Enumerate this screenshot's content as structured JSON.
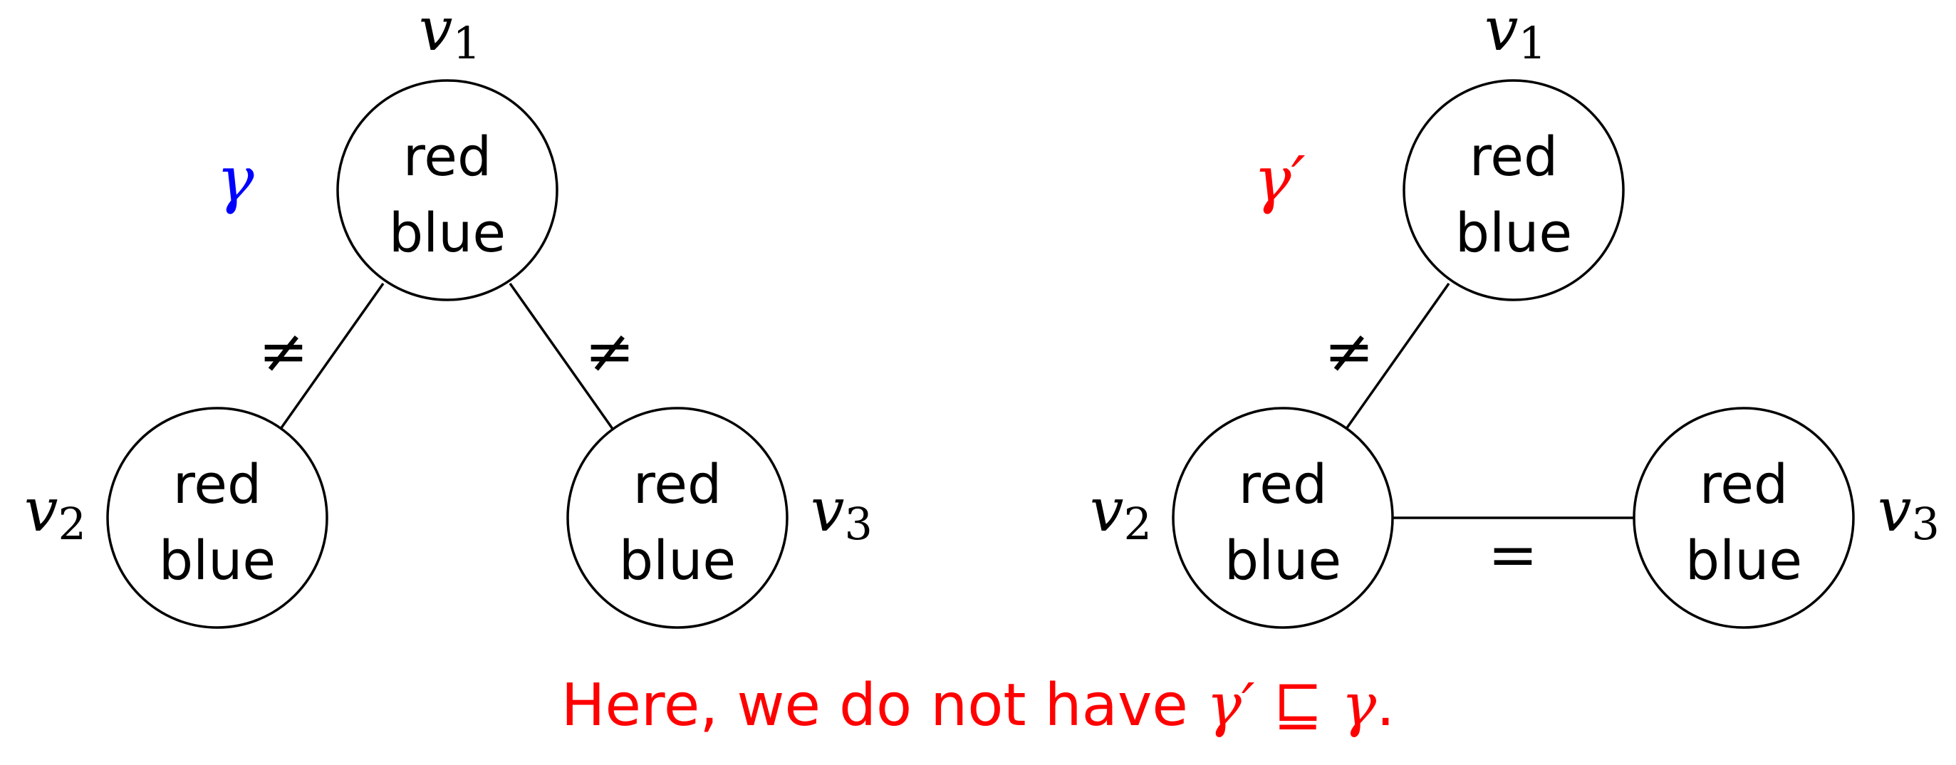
{
  "colors": {
    "gamma": "#0000ff",
    "gamma_prime": "#ff0000",
    "caption": "#ff0000",
    "stroke": "#000000"
  },
  "values_in_node": {
    "line1": "red",
    "line2": "blue"
  },
  "left_graph": {
    "name": "γ",
    "vertices": [
      {
        "label": "v",
        "sub": "1"
      },
      {
        "label": "v",
        "sub": "2"
      },
      {
        "label": "v",
        "sub": "3"
      }
    ],
    "edges": [
      {
        "from": "v1",
        "to": "v2",
        "relation": "≠"
      },
      {
        "from": "v1",
        "to": "v3",
        "relation": "≠"
      }
    ]
  },
  "right_graph": {
    "name": "γ′",
    "vertices": [
      {
        "label": "v",
        "sub": "1"
      },
      {
        "label": "v",
        "sub": "2"
      },
      {
        "label": "v",
        "sub": "3"
      }
    ],
    "edges": [
      {
        "from": "v1",
        "to": "v2",
        "relation": "≠"
      },
      {
        "from": "v2",
        "to": "v3",
        "relation": "="
      }
    ]
  },
  "caption": {
    "text": "Here, we do not have",
    "lhs": "γ′",
    "operator": "⊑",
    "rhs": "γ",
    "end": "."
  }
}
